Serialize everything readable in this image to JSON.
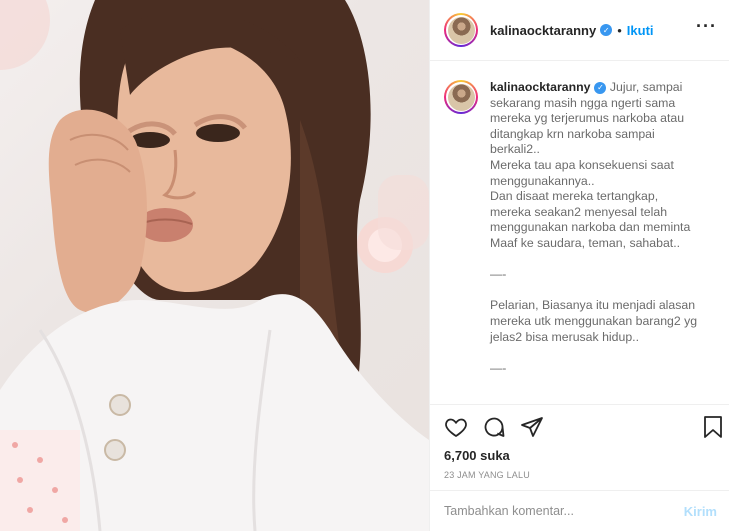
{
  "post": {
    "username": "kalinaocktaranny",
    "follow_label": "Ikuti",
    "more_label": "···",
    "caption_first": "Jujur, sampai",
    "caption_lines": [
      "sekarang masih ngga ngerti sama",
      "mereka yg terjerumus narkoba atau",
      "ditangkap krn narkoba sampai",
      "berkali2..",
      "Mereka tau apa konsekuensi saat",
      "menggunakannya..",
      "Dan disaat mereka tertangkap,",
      "mereka seakan2 menyesal telah",
      "menggunakan narkoba dan meminta",
      "Maaf ke saudara, teman, sahabat..",
      "",
      "—-",
      "",
      "Pelarian, Biasanya itu menjadi alasan",
      "mereka utk menggunakan barang2 yg",
      "jelas2 bisa merusak hidup..",
      "",
      "—-"
    ],
    "likes": "6,700 suka",
    "timestamp": "23 JAM YANG LALU",
    "comment_placeholder": "Tambahkan komentar...",
    "post_label": "Kirim"
  },
  "icons": {
    "like": "heart-icon",
    "comment": "comment-bubble-icon",
    "share": "paper-plane-icon",
    "save": "bookmark-icon",
    "verified": "verified-badge-icon"
  },
  "colors": {
    "follow": "#0095f6",
    "verified": "#3897f0",
    "post_button_disabled": "#b2dffc"
  }
}
